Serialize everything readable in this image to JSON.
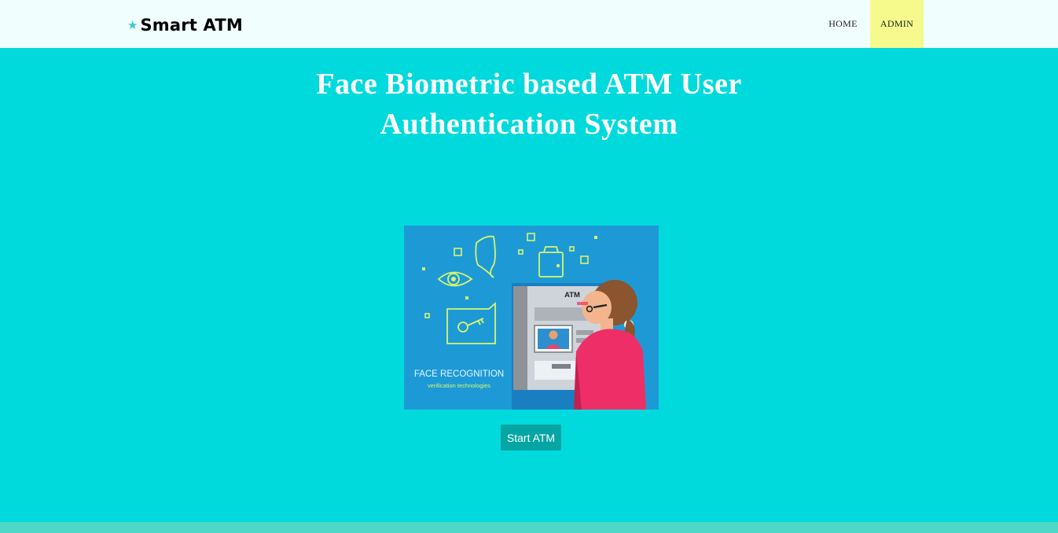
{
  "brand": {
    "icon": "star-icon",
    "star_glyph": "★",
    "name": "Smart ATM"
  },
  "nav": {
    "home": "HOME",
    "admin": "ADMIN"
  },
  "hero": {
    "title_line1": "Face Biometric based ATM User",
    "title_line2": "Authentication System"
  },
  "illustration": {
    "caption": "FACE RECOGNITION",
    "subcaption": "verification technologies",
    "atm_label": "ATM"
  },
  "actions": {
    "start_label": "Start ATM"
  },
  "colors": {
    "page_bg": "#00dadc",
    "navbar_bg": "#f0fffe",
    "admin_highlight": "#f6fa8c",
    "button_bg": "#05a5a4",
    "footer": "#4dd8c8"
  }
}
